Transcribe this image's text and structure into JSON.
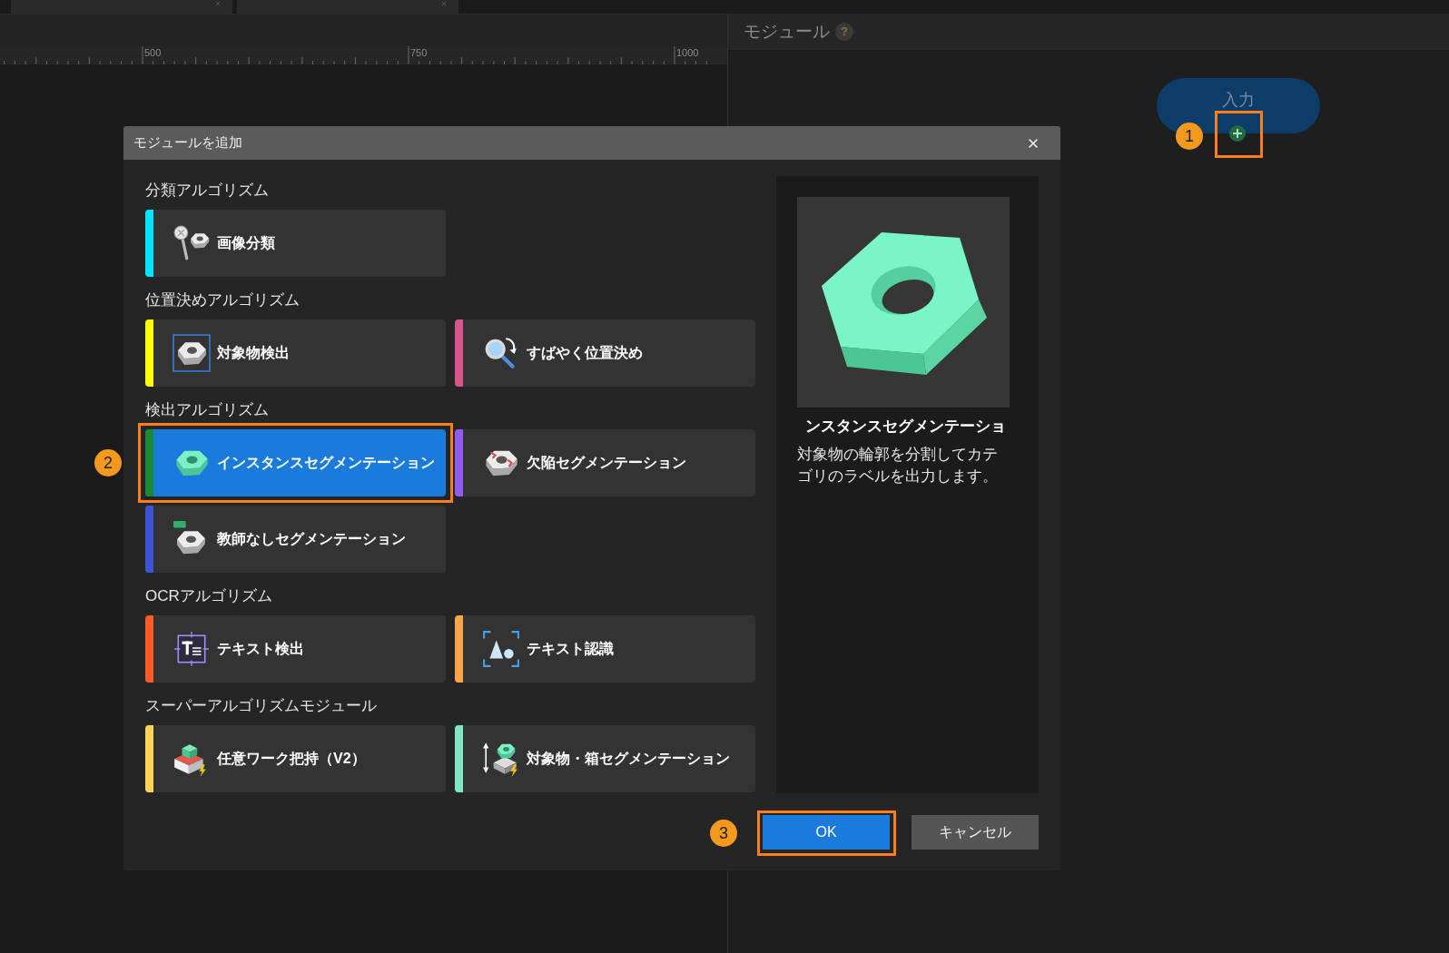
{
  "ruler": {
    "labels": [
      "500",
      "750",
      "1000"
    ]
  },
  "module_panel": {
    "title": "モジュール",
    "help": "?",
    "node": {
      "label": "入力",
      "callout": "1"
    }
  },
  "dialog": {
    "title": "モジュールを追加",
    "sections": [
      {
        "heading": "分類アルゴリズム",
        "modules": [
          {
            "label": "画像分類",
            "color": "#00e5ff",
            "selected": false
          }
        ]
      },
      {
        "heading": "位置決めアルゴリズム",
        "modules": [
          {
            "label": "対象物検出",
            "color": "#ffff00",
            "selected": false
          },
          {
            "label": "すばやく位置決め",
            "color": "#d9548a",
            "selected": false
          }
        ]
      },
      {
        "heading": "検出アルゴリズム",
        "modules": [
          {
            "label": "インスタンスセグメンテーション",
            "color": "#198a33",
            "selected": true,
            "callout": "2"
          },
          {
            "label": "欠陥セグメンテーション",
            "color": "#8d5cf6",
            "selected": false
          },
          {
            "label": "教師なしセグメンテーション",
            "color": "#3d52d5",
            "selected": false
          }
        ]
      },
      {
        "heading": "OCRアルゴリズム",
        "modules": [
          {
            "label": "テキスト検出",
            "color": "#ff5a26",
            "selected": false
          },
          {
            "label": "テキスト認識",
            "color": "#ffa447",
            "selected": false
          }
        ]
      },
      {
        "heading": "スーパーアルゴリズムモジュール",
        "modules": [
          {
            "label": "任意ワーク把持（V2）",
            "color": "#ffd454",
            "selected": false
          },
          {
            "label": "対象物・箱セグメンテーション",
            "color": "#7ee8c3",
            "selected": false
          }
        ]
      }
    ],
    "preview": {
      "title": "ンスタンスセグメンテーショ",
      "description": "対象物の輪郭を分割してカテゴリのラベルを出力します。"
    },
    "buttons": [
      {
        "label": "OK",
        "kind": "primary",
        "callout": "3"
      },
      {
        "label": "キャンセル",
        "kind": "secondary"
      }
    ]
  }
}
